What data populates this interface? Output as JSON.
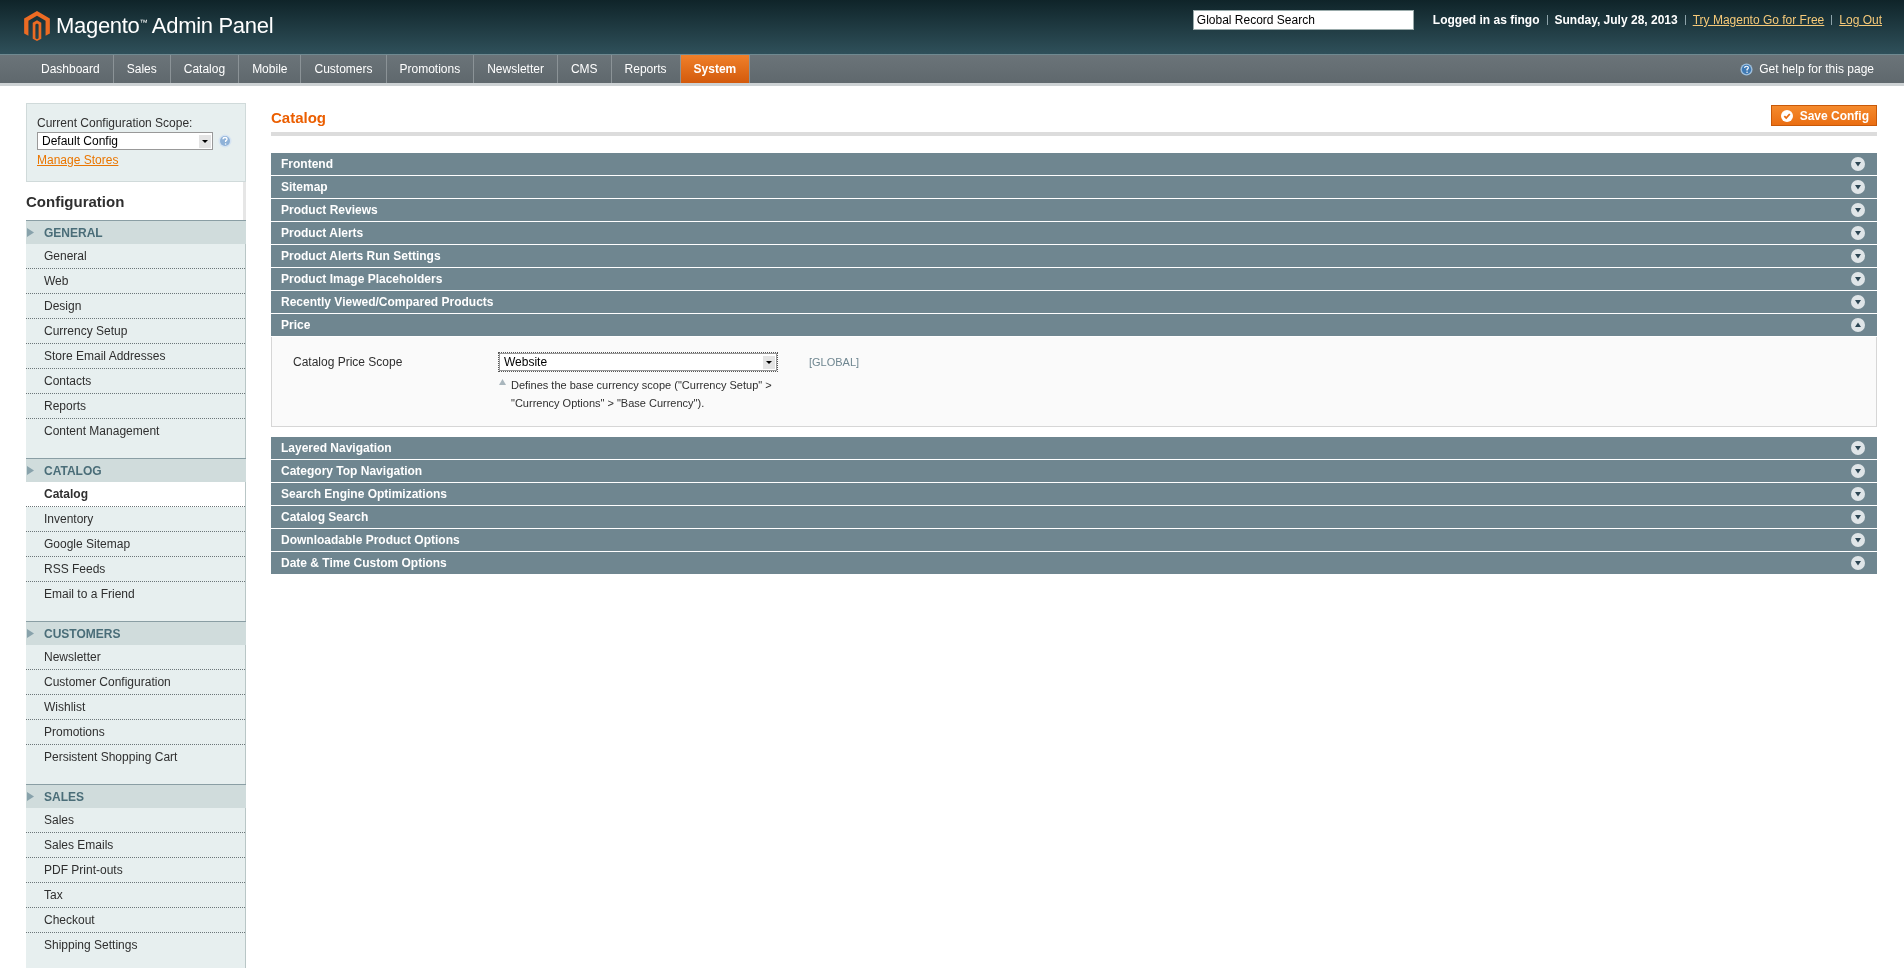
{
  "header": {
    "logo": "Magento$^{™}$ Admin Panel",
    "search": {
      "value": "Global Record Search"
    },
    "user": "Logged in as fingo",
    "date": "Sunday, July 28, 2013",
    "links": [
      "Try Magento Go for Free",
      "Log Out"
    ]
  },
  "nav": [
    {
      "label": "Dashboard",
      "selected": false
    },
    {
      "label": "Sales",
      "selected": false
    },
    {
      "label": "Catalog",
      "selected": false
    },
    {
      "label": "Mobile",
      "selected": false
    },
    {
      "label": "Customers",
      "selected": false
    },
    {
      "label": "Promotions",
      "selected": false
    },
    {
      "label": "Newsletter",
      "selected": false
    },
    {
      "label": "CMS",
      "selected": false
    },
    {
      "label": "Reports",
      "selected": false
    },
    {
      "label": "System",
      "selected": true
    }
  ],
  "help": "Get help for this page",
  "sidebar": {
    "scope_label": "Current Configuration Scope:",
    "scope_value": "Default Config",
    "manage_link": "Manage Stores",
    "title": "Configuration",
    "sections": [
      {
        "title": "GENERAL",
        "items": [
          {
            "label": "General",
            "selected": false
          },
          {
            "label": "Web",
            "selected": false
          },
          {
            "label": "Design",
            "selected": false
          },
          {
            "label": "Currency Setup",
            "selected": false
          },
          {
            "label": "Store Email Addresses",
            "selected": false
          },
          {
            "label": "Contacts",
            "selected": false
          },
          {
            "label": "Reports",
            "selected": false
          },
          {
            "label": "Content Management",
            "selected": false
          }
        ]
      },
      {
        "title": "CATALOG",
        "items": [
          {
            "label": "Catalog",
            "selected": true
          },
          {
            "label": "Inventory",
            "selected": false
          },
          {
            "label": "Google Sitemap",
            "selected": false
          },
          {
            "label": "RSS Feeds",
            "selected": false
          },
          {
            "label": "Email to a Friend",
            "selected": false
          }
        ]
      },
      {
        "title": "CUSTOMERS",
        "items": [
          {
            "label": "Newsletter",
            "selected": false
          },
          {
            "label": "Customer Configuration",
            "selected": false
          },
          {
            "label": "Wishlist",
            "selected": false
          },
          {
            "label": "Promotions",
            "selected": false
          },
          {
            "label": "Persistent Shopping Cart",
            "selected": false
          }
        ]
      },
      {
        "title": "SALES",
        "items": [
          {
            "label": "Sales",
            "selected": false
          },
          {
            "label": "Sales Emails",
            "selected": false
          },
          {
            "label": "PDF Print-outs",
            "selected": false
          },
          {
            "label": "Tax",
            "selected": false
          },
          {
            "label": "Checkout",
            "selected": false
          },
          {
            "label": "Shipping Settings",
            "selected": false
          }
        ]
      }
    ]
  },
  "page_title": "Catalog",
  "save_button": "Save Config",
  "groups": [
    {
      "title": "Frontend",
      "expanded": false
    },
    {
      "title": "Sitemap",
      "expanded": false
    },
    {
      "title": "Product Reviews",
      "expanded": false
    },
    {
      "title": "Product Alerts",
      "expanded": false
    },
    {
      "title": "Product Alerts Run Settings",
      "expanded": false
    },
    {
      "title": "Product Image Placeholders",
      "expanded": false
    },
    {
      "title": "Recently Viewed/Compared Products",
      "expanded": false
    },
    {
      "title": "Price",
      "expanded": true,
      "fields": [
        {
          "label": "Catalog Price Scope",
          "value": "Website",
          "scope": "[GLOBAL]",
          "comment": "Defines the base currency scope (\"Currency Setup\" > \"Currency Options\" > \"Base Currency\")."
        }
      ]
    },
    {
      "title": "Layered Navigation",
      "expanded": false
    },
    {
      "title": "Category Top Navigation",
      "expanded": false
    },
    {
      "title": "Search Engine Optimizations",
      "expanded": false
    },
    {
      "title": "Catalog Search",
      "expanded": false
    },
    {
      "title": "Downloadable Product Options",
      "expanded": false
    },
    {
      "title": "Date & Time Custom Options",
      "expanded": false
    }
  ]
}
